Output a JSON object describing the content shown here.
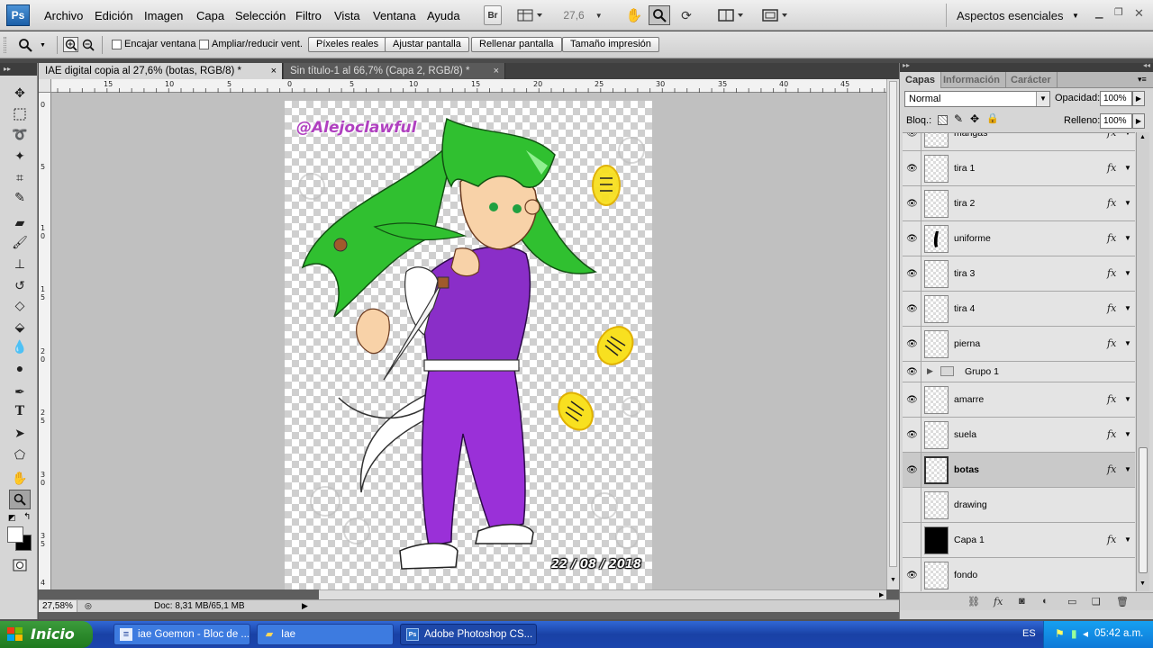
{
  "menubar": {
    "logo": "Ps",
    "items": [
      "Archivo",
      "Edición",
      "Imagen",
      "Capa",
      "Selección",
      "Filtro",
      "Vista",
      "Ventana",
      "Ayuda"
    ],
    "bridge_label": "Br",
    "zoom_value": "27,6",
    "workspace": "Aspectos esenciales"
  },
  "options": {
    "encajar": "Encajar ventana",
    "ampliar": "Ampliar/reducir vent.",
    "buttons": [
      "Píxeles reales",
      "Ajustar pantalla",
      "Rellenar pantalla",
      "Tamaño impresión"
    ]
  },
  "documents": {
    "tabs": [
      {
        "label": "IAE digital copia al 27,6% (botas, RGB/8) *",
        "close": "×"
      },
      {
        "label": "Sin título-1 al 66,7% (Capa 2, RGB/8) *",
        "close": "×"
      }
    ],
    "ruler_h": [
      "15",
      "10",
      "5",
      "0",
      "5",
      "10",
      "15",
      "20",
      "25",
      "30",
      "35",
      "40",
      "45"
    ],
    "ruler_v": [
      "0",
      "5",
      "1 0",
      "1 5",
      "2 0",
      "2 5",
      "3 0",
      "3 5",
      "4"
    ],
    "canvas_watermark": "@Alejoclawful",
    "canvas_date": "22 / 08 / 2018"
  },
  "status": {
    "zoom": "27,58%",
    "doc": "Doc: 8,31 MB/65,1 MB"
  },
  "panel": {
    "tabs": [
      "Capas",
      "Información",
      "Carácter"
    ],
    "blend_mode": "Normal",
    "opacity_label": "Opacidad:",
    "opacity_value": "100%",
    "lock_label": "Bloq.:",
    "fill_label": "Relleno:",
    "fill_value": "100%",
    "layers": [
      {
        "name": "mangas",
        "visible": true,
        "fx": true
      },
      {
        "name": "tira 1",
        "visible": true,
        "fx": true
      },
      {
        "name": "tira 2",
        "visible": true,
        "fx": true
      },
      {
        "name": "uniforme",
        "visible": true,
        "fx": true
      },
      {
        "name": "tira 3",
        "visible": true,
        "fx": true
      },
      {
        "name": "tira 4",
        "visible": true,
        "fx": true
      },
      {
        "name": "pierna",
        "visible": true,
        "fx": true
      },
      {
        "name": "Grupo 1",
        "visible": true,
        "group": true
      },
      {
        "name": "amarre",
        "visible": true,
        "fx": true
      },
      {
        "name": "suela",
        "visible": true,
        "fx": true
      },
      {
        "name": "botas",
        "visible": true,
        "fx": true,
        "selected": true
      },
      {
        "name": "drawing",
        "visible": false,
        "fx": false
      },
      {
        "name": "Capa 1",
        "visible": false,
        "fx": true,
        "black": true
      },
      {
        "name": "fondo",
        "visible": true,
        "fx": false
      }
    ],
    "fx_label": "fx"
  },
  "taskbar": {
    "start": "Inicio",
    "items": [
      {
        "label": "iae Goemon - Bloc de ...",
        "icon": "notepad-icon"
      },
      {
        "label": "Iae",
        "icon": "folder-icon"
      },
      {
        "label": "Adobe Photoshop CS...",
        "icon": "photoshop-icon"
      }
    ],
    "lang": "ES",
    "clock": "05:42 a.m."
  }
}
